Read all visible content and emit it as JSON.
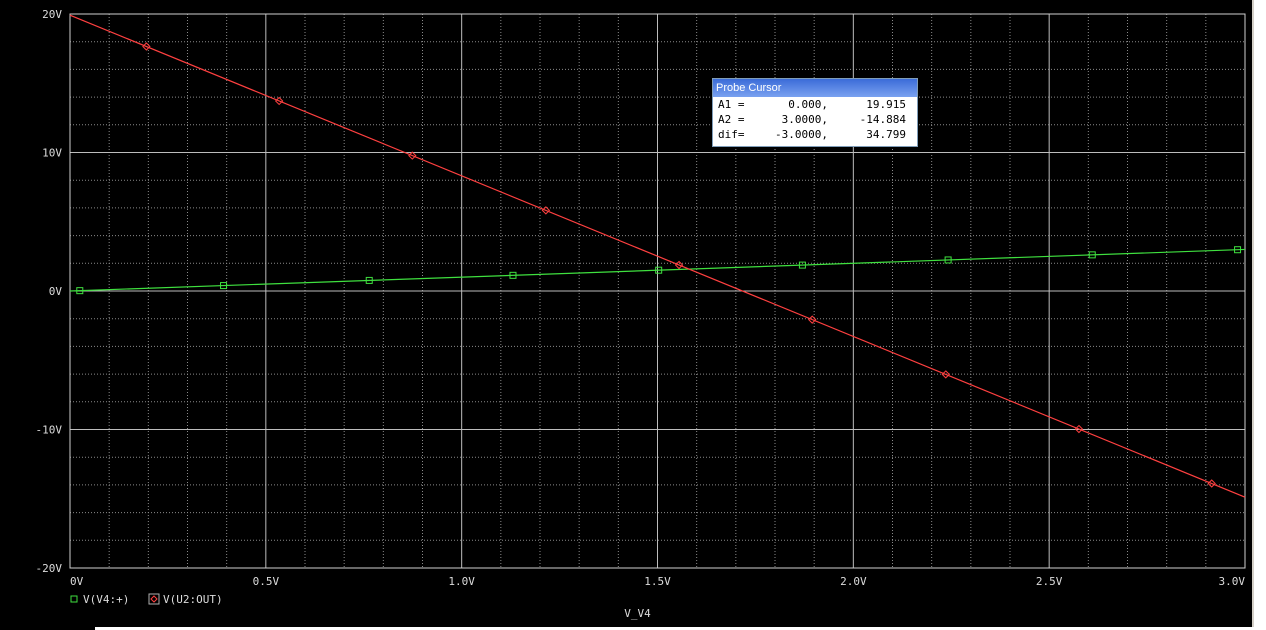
{
  "window": {
    "background": "#000000"
  },
  "probe_cursor": {
    "title": "Probe Cursor",
    "rows": [
      {
        "label": "A1 =",
        "x": "0.000,",
        "y": "19.915"
      },
      {
        "label": "A2 =",
        "x": "3.0000,",
        "y": "-14.884"
      },
      {
        "label": "dif=",
        "x": "-3.0000,",
        "y": "34.799"
      }
    ]
  },
  "chart_data": {
    "type": "line",
    "xlabel": "V_V4",
    "ylabel": "",
    "xlim": [
      0,
      3.0
    ],
    "ylim": [
      -20,
      20
    ],
    "grid": true,
    "x_ticks": [
      {
        "value": 0,
        "label": "0V"
      },
      {
        "value": 0.5,
        "label": "0.5V"
      },
      {
        "value": 1.0,
        "label": "1.0V"
      },
      {
        "value": 1.5,
        "label": "1.5V"
      },
      {
        "value": 2.0,
        "label": "2.0V"
      },
      {
        "value": 2.5,
        "label": "2.5V"
      },
      {
        "value": 3.0,
        "label": "3.0V"
      }
    ],
    "y_ticks": [
      {
        "value": 20,
        "label": "20V"
      },
      {
        "value": 10,
        "label": "10V"
      },
      {
        "value": 0,
        "label": "0V"
      },
      {
        "value": -10,
        "label": "-10V"
      },
      {
        "value": -20,
        "label": "-20V"
      }
    ],
    "series": [
      {
        "name": "V(V4:+)",
        "color": "#3fe03f",
        "marker": "square",
        "x": [
          0,
          3.0
        ],
        "y": [
          0,
          3.0
        ],
        "marker_x": [
          0.025,
          0.392,
          0.764,
          1.131,
          1.503,
          1.87,
          2.242,
          2.61,
          2.981
        ]
      },
      {
        "name": "V(U2:OUT)",
        "color": "#ff4040",
        "marker": "diamond",
        "x": [
          0,
          3.0
        ],
        "y": [
          19.915,
          -14.884
        ],
        "marker_x": [
          0.195,
          0.534,
          0.874,
          1.215,
          1.555,
          1.895,
          2.236,
          2.576,
          2.915
        ]
      }
    ],
    "legend_position": "bottom-left"
  }
}
